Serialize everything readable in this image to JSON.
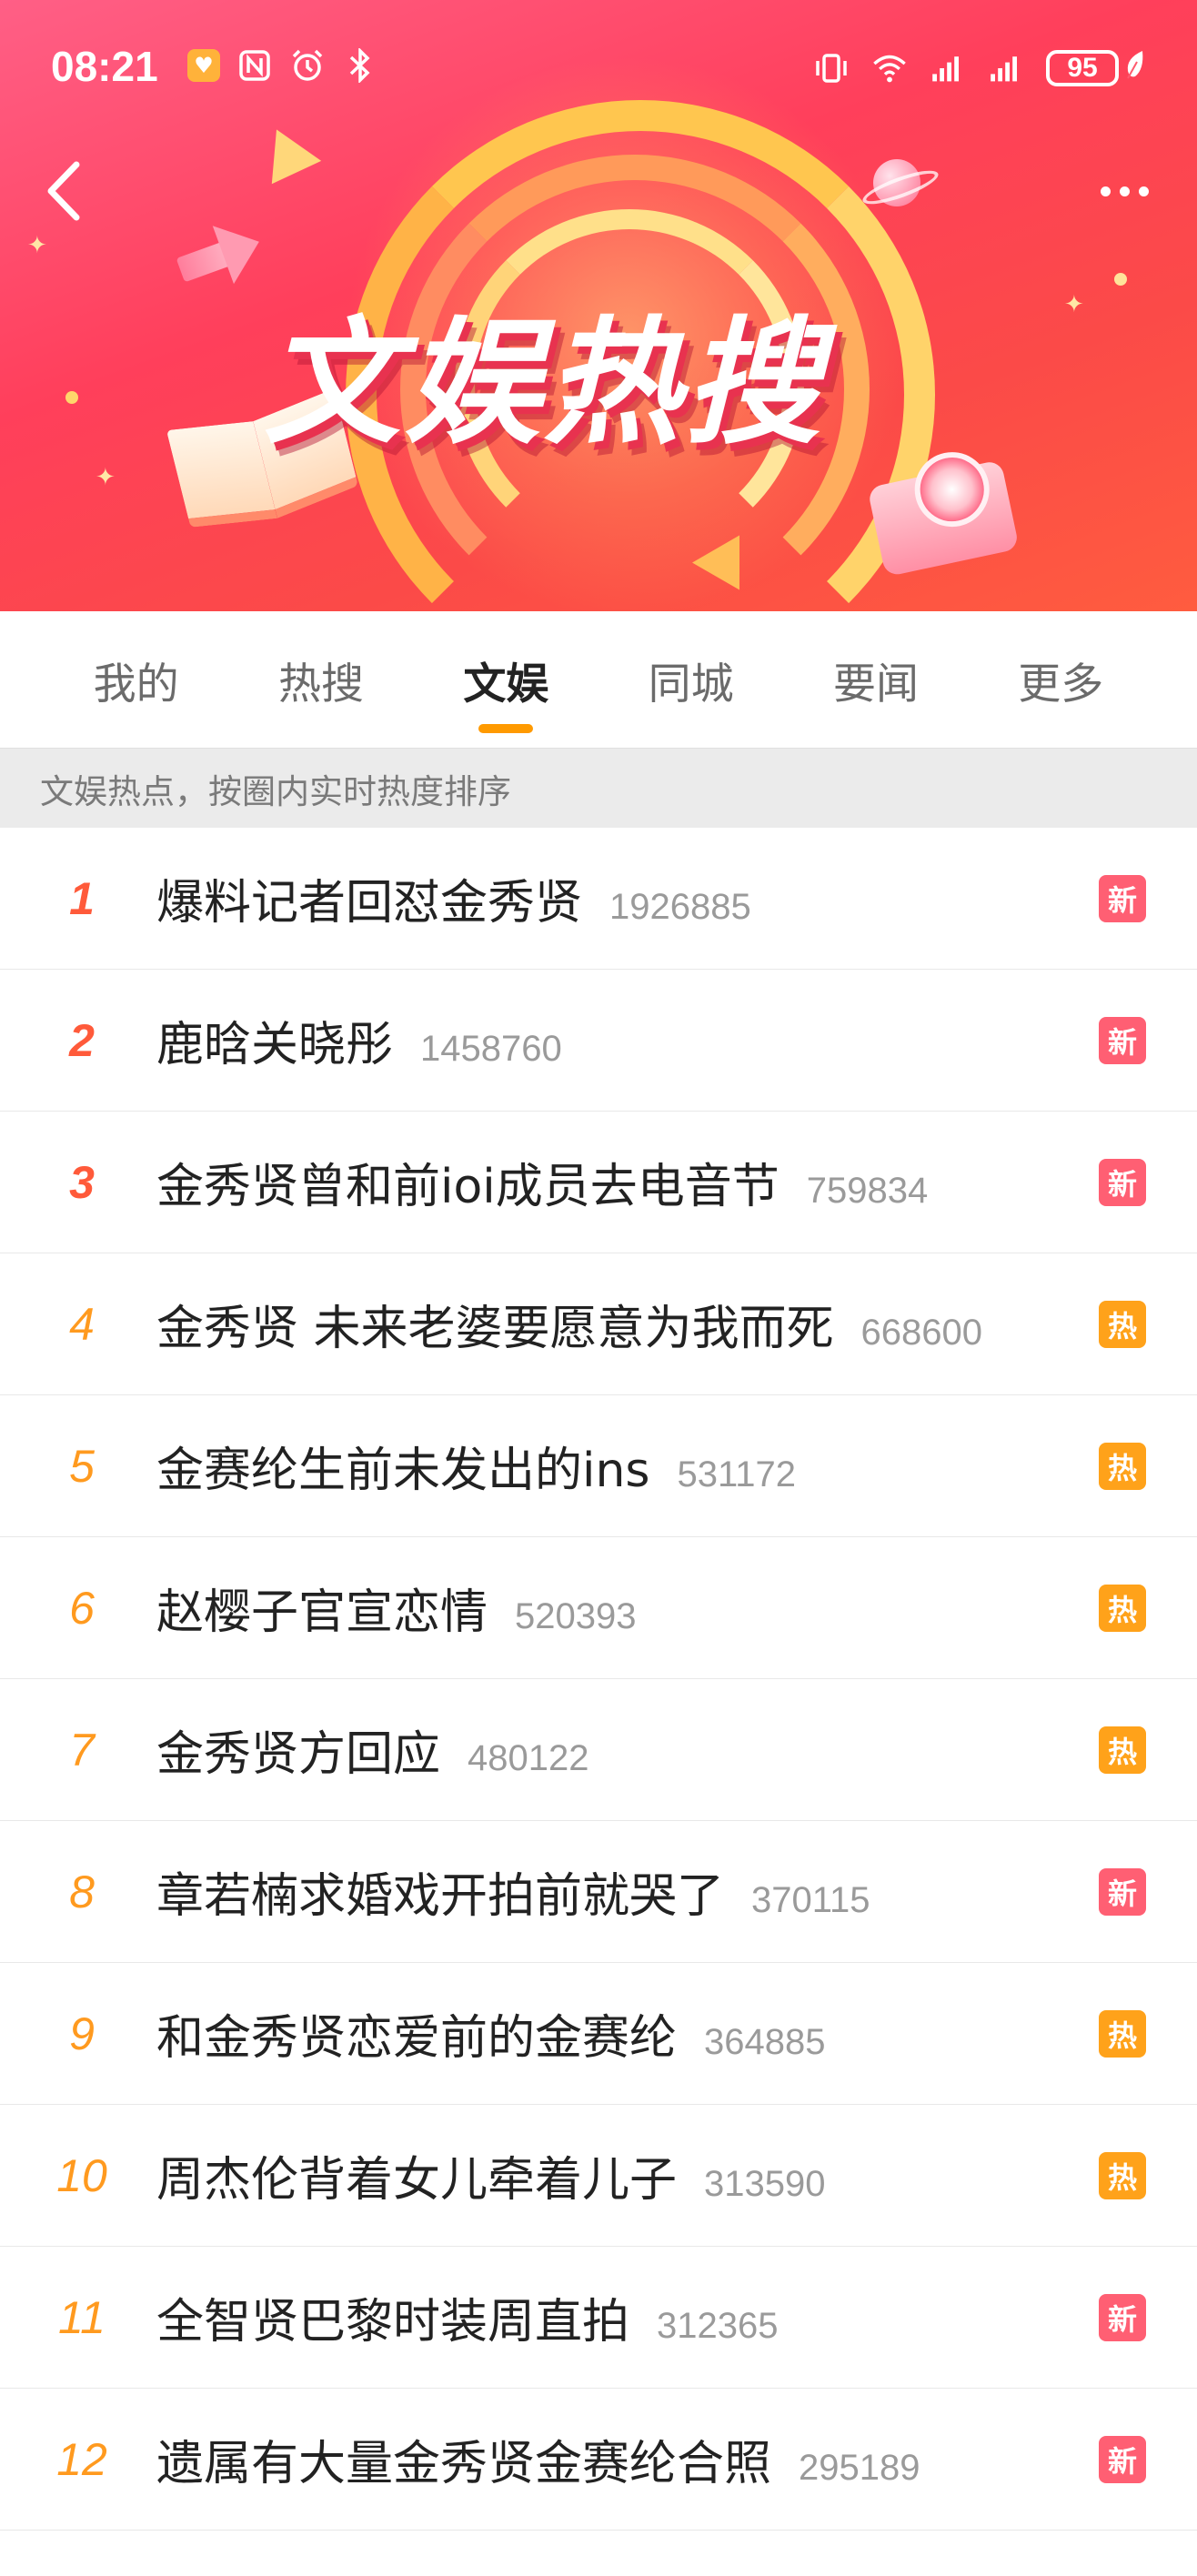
{
  "status_bar": {
    "time": "08:21",
    "battery": "95"
  },
  "banner": {
    "title": "文娱热搜"
  },
  "tabs": [
    {
      "label": "我的",
      "active": false
    },
    {
      "label": "热搜",
      "active": false
    },
    {
      "label": "文娱",
      "active": true
    },
    {
      "label": "同城",
      "active": false
    },
    {
      "label": "要闻",
      "active": false
    },
    {
      "label": "更多",
      "active": false
    }
  ],
  "subheader": "文娱热点，按圈内实时热度排序",
  "items": [
    {
      "rank": "1",
      "title": "爆料记者回怼金秀贤",
      "count": "1926885",
      "badge": "新"
    },
    {
      "rank": "2",
      "title": "鹿晗关晓彤",
      "count": "1458760",
      "badge": "新"
    },
    {
      "rank": "3",
      "title": "金秀贤曾和前ioi成员去电音节",
      "count": "759834",
      "badge": "新"
    },
    {
      "rank": "4",
      "title": "金秀贤 未来老婆要愿意为我而死",
      "count": "668600",
      "badge": "热"
    },
    {
      "rank": "5",
      "title": "金赛纶生前未发出的ins",
      "count": "531172",
      "badge": "热"
    },
    {
      "rank": "6",
      "title": "赵樱子官宣恋情",
      "count": "520393",
      "badge": "热"
    },
    {
      "rank": "7",
      "title": "金秀贤方回应",
      "count": "480122",
      "badge": "热"
    },
    {
      "rank": "8",
      "title": "章若楠求婚戏开拍前就哭了",
      "count": "370115",
      "badge": "新"
    },
    {
      "rank": "9",
      "title": "和金秀贤恋爱前的金赛纶",
      "count": "364885",
      "badge": "热"
    },
    {
      "rank": "10",
      "title": "周杰伦背着女儿牵着儿子",
      "count": "313590",
      "badge": "热"
    },
    {
      "rank": "11",
      "title": "全智贤巴黎时装周直拍",
      "count": "312365",
      "badge": "新"
    },
    {
      "rank": "12",
      "title": "遗属有大量金秀贤金赛纶合照",
      "count": "295189",
      "badge": "新"
    }
  ],
  "colors": {
    "rank_top": "#ff5a3a",
    "rank_other": "#ff9a1f",
    "badge_new": "#ff5f73",
    "badge_hot": "#ffa21a",
    "tab_indicator": "#ff9a00"
  }
}
